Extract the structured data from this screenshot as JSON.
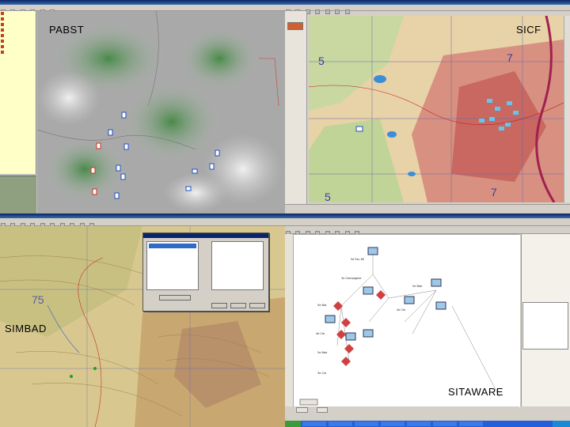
{
  "panels": {
    "pabst": {
      "label": "PABST"
    },
    "sicf": {
      "label": "SICF"
    },
    "simbad": {
      "label": "SIMBAD"
    },
    "sitaware": {
      "label": "SITAWARE"
    }
  },
  "sicf_map": {
    "grid_labels": [
      "5",
      "7",
      "5",
      "7"
    ]
  },
  "simbad_map": {
    "grid_labels": [
      "75"
    ]
  },
  "sitaware_nodes": [
    "5e Esc 60",
    "3e Compagnie",
    "5e Bde",
    "4e Cie",
    "5e Bat",
    "4e Cie",
    "5e Bde",
    "3e Cie"
  ],
  "colors": {
    "unit_friendly": "#2050c0",
    "unit_hostile": "#d03020",
    "sicf_unit": "#60c8f0",
    "sitaware_node": "#9ec8e8",
    "sitaware_hostile": "#d04040"
  }
}
